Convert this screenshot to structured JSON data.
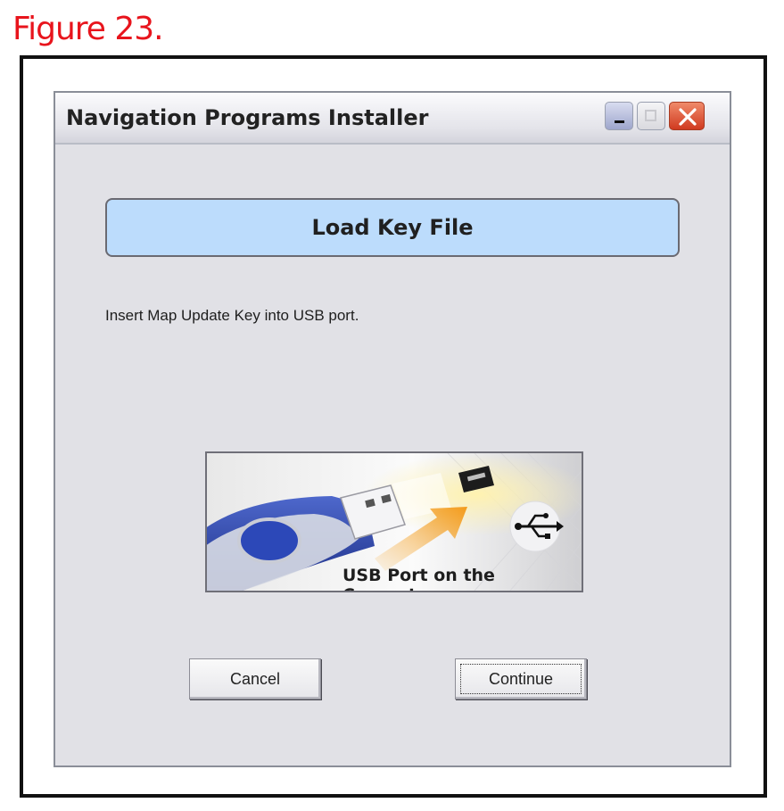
{
  "figure_label": "Figure 23.",
  "window": {
    "title": "Navigation Programs Installer",
    "heading": "Load Key File",
    "instruction": "Insert Map Update Key into USB port.",
    "image_caption": "USB Port on the Computer",
    "cancel_label": "Cancel",
    "continue_label": "Continue"
  },
  "colors": {
    "figure_label": "#e8141c",
    "heading_box": "#bcdcfc",
    "window_bg": "#e1e1e6",
    "usb_body": "#2b44a8"
  },
  "icons": [
    "minimize-icon",
    "maximize-icon",
    "close-icon",
    "usb-symbol-icon"
  ]
}
